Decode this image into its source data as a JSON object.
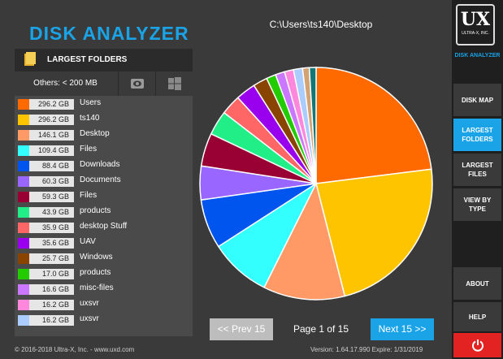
{
  "app_title": "DISK ANALYZER",
  "path": "C:\\Users\\ts140\\Desktop",
  "left_panel": {
    "header_label": "LARGEST FOLDERS",
    "others_label": "Others: < 200 MB",
    "rows": [
      {
        "size": "296.2 GB",
        "name": "Users",
        "color": "#ff6a00"
      },
      {
        "size": "296.2 GB",
        "name": "ts140",
        "color": "#ffc400"
      },
      {
        "size": "146.1 GB",
        "name": "Desktop",
        "color": "#ff9966"
      },
      {
        "size": "109.4 GB",
        "name": "Files",
        "color": "#33ffff"
      },
      {
        "size": "88.4 GB",
        "name": "Downloads",
        "color": "#0055ee"
      },
      {
        "size": "60.3 GB",
        "name": "Documents",
        "color": "#9966ff"
      },
      {
        "size": "59.3 GB",
        "name": "Files",
        "color": "#990033"
      },
      {
        "size": "43.9 GB",
        "name": "products",
        "color": "#22ee88"
      },
      {
        "size": "35.9 GB",
        "name": "desktop Stuff",
        "color": "#ff6666"
      },
      {
        "size": "35.6 GB",
        "name": "UAV",
        "color": "#9900ee"
      },
      {
        "size": "25.7 GB",
        "name": "Windows",
        "color": "#884400"
      },
      {
        "size": "17.0 GB",
        "name": "products",
        "color": "#22cc00"
      },
      {
        "size": "16.6 GB",
        "name": "misc-files",
        "color": "#cc77ff"
      },
      {
        "size": "16.2 GB",
        "name": "uxsvr",
        "color": "#ff88dd"
      },
      {
        "size": "16.2 GB",
        "name": "uxsvr",
        "color": "#aaccff"
      }
    ],
    "remainder_colors": [
      "#d4a373",
      "#117777"
    ]
  },
  "pager": {
    "prev_label": "<< Prev 15",
    "page_text": "Page 1 of 15",
    "next_label": "Next 15 >>"
  },
  "footer": {
    "copyright": "© 2016-2018 Ultra-X, Inc. - www.uxd.com",
    "version": "Version: 1.64.17.990   Expire: 1/31/2019"
  },
  "sidebar": {
    "logo_text": "UX",
    "logo_sub": "ULTRA-X, INC.",
    "logo_caption": "DISK ANALYZER",
    "items": [
      {
        "label": "DISK MAP",
        "active": false
      },
      {
        "label": "LARGEST FOLDERS",
        "active": true
      },
      {
        "label": "LARGEST FILES",
        "active": false
      },
      {
        "label": "VIEW BY TYPE",
        "active": false
      },
      {
        "label": "ABOUT",
        "active": false
      },
      {
        "label": "HELP",
        "active": false
      }
    ]
  },
  "colors": {
    "accent": "#1aa3e6",
    "power": "#e32222"
  }
}
